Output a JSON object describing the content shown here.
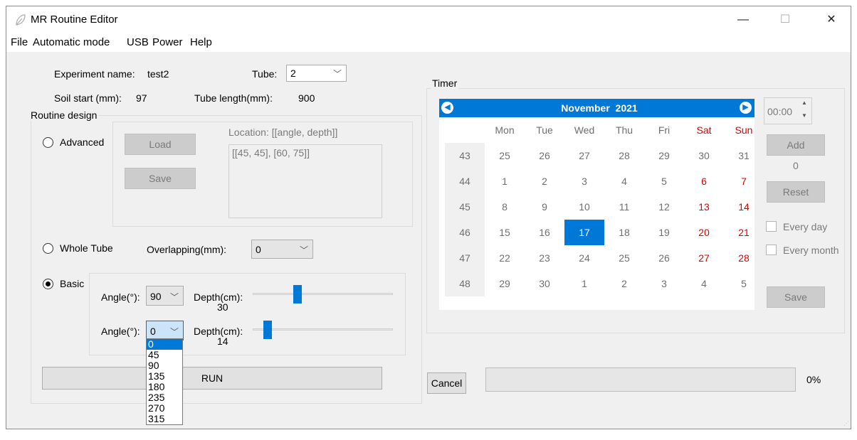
{
  "window": {
    "title": "MR Routine Editor",
    "controls": {
      "minimize": "—",
      "maximize": "☐",
      "close": "✕"
    }
  },
  "menu": [
    "File",
    "Automatic mode",
    "USB",
    "Power",
    "Help"
  ],
  "info": {
    "experiment_label": "Experiment name:",
    "experiment_value": "test2",
    "tube_label": "Tube:",
    "tube_value": "2",
    "soil_label": "Soil start (mm):",
    "soil_value": "97",
    "tube_length_label": "Tube length(mm):",
    "tube_length_value": "900"
  },
  "routine": {
    "group_title": "Routine design",
    "advanced": {
      "label": "Advanced",
      "load": "Load",
      "save": "Save",
      "location_label": "Location: [[angle, depth]]",
      "location_value": "[[45, 45], [60, 75]]"
    },
    "whole_tube": {
      "label": "Whole Tube",
      "overlap_label": "Overlapping(mm):",
      "overlap_value": "0"
    },
    "basic": {
      "label": "Basic",
      "selected": true,
      "rows": [
        {
          "angle_label": "Angle(°):",
          "angle_value": "90",
          "depth_label": "Depth(cm):",
          "depth_value": "30",
          "slider_fraction": 0.31
        },
        {
          "angle_label": "Angle(°):",
          "angle_value": "0",
          "depth_label": "Depth(cm):",
          "depth_value": "14",
          "slider_fraction": 0.08
        }
      ]
    },
    "angle_options": [
      "0",
      "45",
      "90",
      "135",
      "180",
      "235",
      "270",
      "315"
    ],
    "angle_highlighted": "0",
    "run_label": "RUN"
  },
  "timer": {
    "group_title": "Timer",
    "month_label": "November  2021",
    "day_headers": [
      "Mon",
      "Tue",
      "Wed",
      "Thu",
      "Fri",
      "Sat",
      "Sun"
    ],
    "weeks": [
      {
        "num": "43",
        "days": [
          "25",
          "26",
          "27",
          "28",
          "29",
          "30",
          "31"
        ]
      },
      {
        "num": "44",
        "days": [
          "1",
          "2",
          "3",
          "4",
          "5",
          "6",
          "7"
        ]
      },
      {
        "num": "45",
        "days": [
          "8",
          "9",
          "10",
          "11",
          "12",
          "13",
          "14"
        ]
      },
      {
        "num": "46",
        "days": [
          "15",
          "16",
          "17",
          "18",
          "19",
          "20",
          "21"
        ]
      },
      {
        "num": "47",
        "days": [
          "22",
          "23",
          "24",
          "25",
          "26",
          "27",
          "28"
        ]
      },
      {
        "num": "48",
        "days": [
          "29",
          "30",
          "1",
          "2",
          "3",
          "4",
          "5"
        ]
      }
    ],
    "selected_day": "17",
    "time_value": "00:00",
    "add_label": "Add",
    "count_value": "0",
    "reset_label": "Reset",
    "every_day_label": "Every day",
    "every_month_label": "Every month",
    "save_label": "Save"
  },
  "footer": {
    "cancel_label": "Cancel",
    "progress_text": "0%",
    "progress_fraction": 0
  },
  "colors": {
    "accent": "#0078d7",
    "weekend": "#e00000",
    "disabled": "#cccccc"
  }
}
